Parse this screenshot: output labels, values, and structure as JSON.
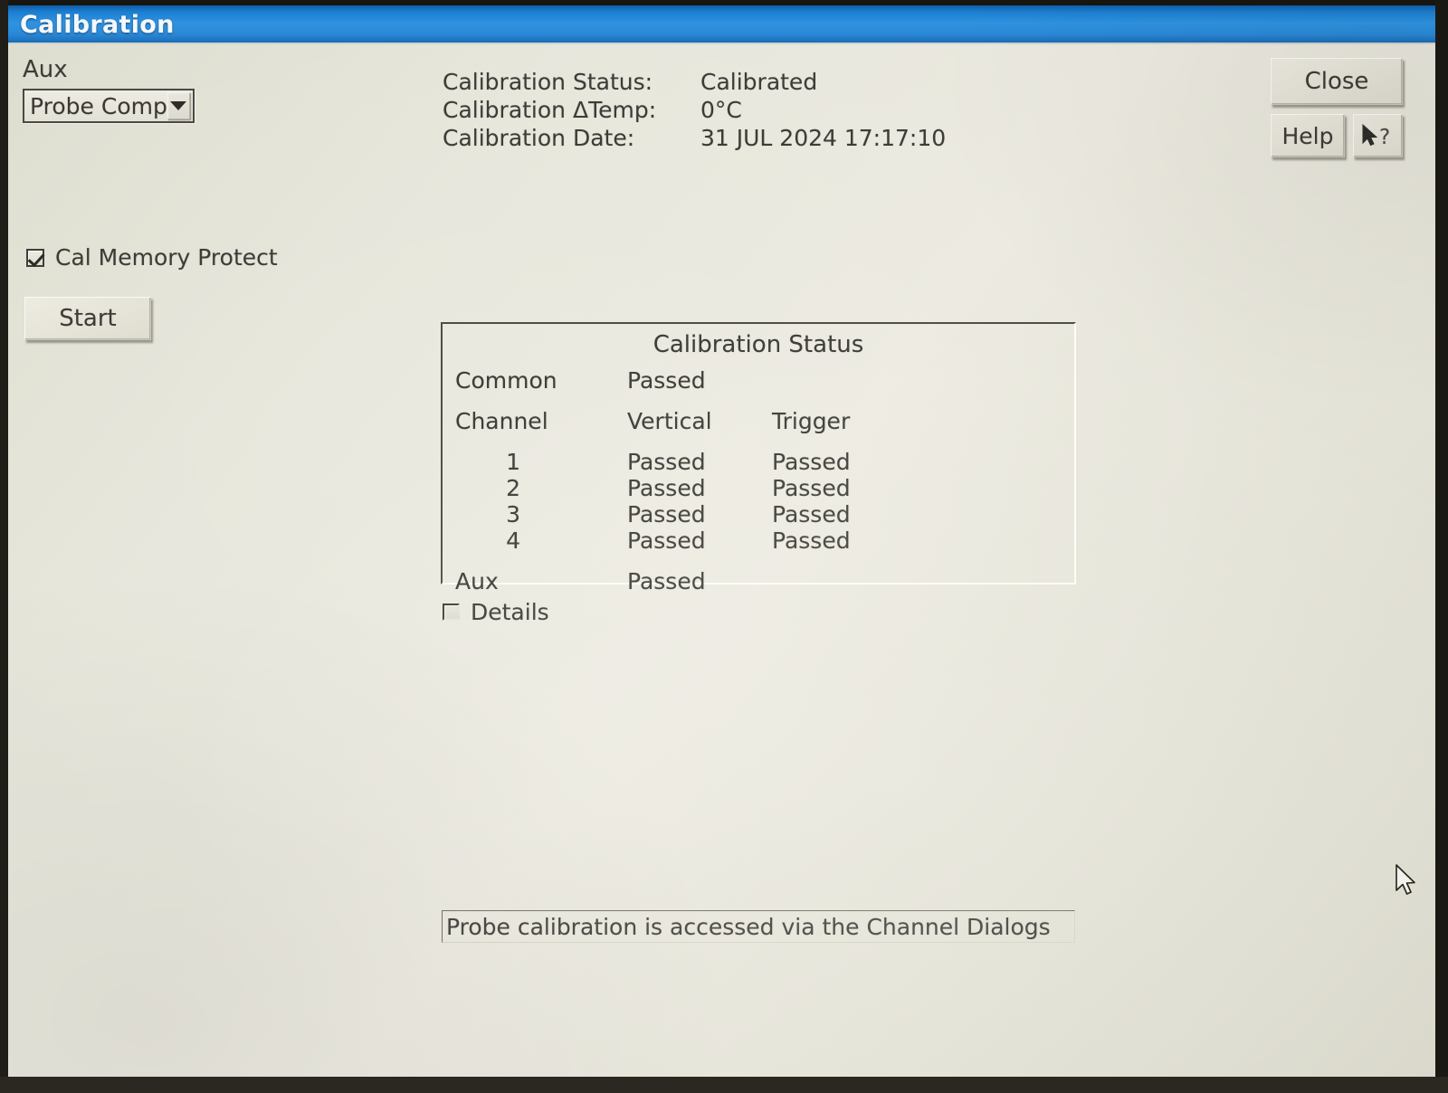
{
  "window": {
    "title": "Calibration",
    "titlebar_color": "#2a88d6",
    "background_color": "#e6e6db"
  },
  "aux": {
    "label": "Aux",
    "select_value": "Probe Comp",
    "select_options": [
      "Probe Comp"
    ],
    "arrow_icon": "chevron-down-icon"
  },
  "cal_info": {
    "status_label": "Calibration Status:",
    "status_value": "Calibrated",
    "temp_label": "Calibration ΔTemp:",
    "temp_value": "0°C",
    "date_label": "Calibration Date:",
    "date_value": "31 JUL 2024 17:17:10"
  },
  "controls": {
    "cal_memory_protect_label": "Cal Memory Protect",
    "cal_memory_protect_checked": true,
    "start_label": "Start",
    "details_label": "Details",
    "details_checked": false
  },
  "buttons": {
    "close_label": "Close",
    "help_label": "Help",
    "context_help_icon": "pointer-question-icon"
  },
  "status_panel": {
    "title": "Calibration Status",
    "common_label": "Common",
    "common_value": "Passed",
    "headers": {
      "channel": "Channel",
      "vertical": "Vertical",
      "trigger": "Trigger"
    },
    "channels": [
      {
        "id": "1",
        "vertical": "Passed",
        "trigger": "Passed"
      },
      {
        "id": "2",
        "vertical": "Passed",
        "trigger": "Passed"
      },
      {
        "id": "3",
        "vertical": "Passed",
        "trigger": "Passed"
      },
      {
        "id": "4",
        "vertical": "Passed",
        "trigger": "Passed"
      }
    ],
    "aux_label": "Aux",
    "aux_value": "Passed"
  },
  "message": {
    "text": "Probe calibration is accessed via the Channel Dialogs"
  }
}
